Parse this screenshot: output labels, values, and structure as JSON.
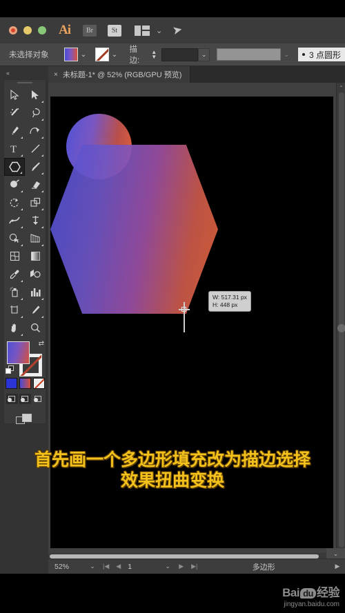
{
  "titlebar": {
    "app_name": "Ai",
    "bridge_label": "Br",
    "stock_label": "St",
    "arrange_icon": "arrange-documents-icon",
    "chevron_icon": "chevron-down-icon",
    "rocket_icon": "rocket-icon",
    "close_dot": "close-window-dot",
    "minimize_dot": "minimize-window-dot",
    "zoom_dot": "zoom-window-dot"
  },
  "controlbar": {
    "selection_status": "未选择对象",
    "fill_swatch_name": "fill-color-swatch",
    "stroke_swatch_name": "stroke-color-swatch",
    "stroke_label": "描边:",
    "stroke_weight_value": "",
    "stroke_profile_value": "",
    "brush_preset_label": "3 点圆形",
    "chevron": "⌄"
  },
  "tab": {
    "close_icon": "×",
    "title": "未标题-1* @ 52% (RGB/GPU 预览)"
  },
  "toolbar": {
    "collapse_icon": "«",
    "tools": [
      {
        "name": "selection-tool",
        "glyph": "selection"
      },
      {
        "name": "direct-selection-tool",
        "glyph": "direct-selection"
      },
      {
        "name": "magic-wand-tool",
        "glyph": "magic-wand"
      },
      {
        "name": "lasso-tool",
        "glyph": "lasso"
      },
      {
        "name": "pen-tool",
        "glyph": "pen"
      },
      {
        "name": "curvature-tool",
        "glyph": "curvature"
      },
      {
        "name": "type-tool",
        "glyph": "T"
      },
      {
        "name": "line-segment-tool",
        "glyph": "line"
      },
      {
        "name": "polygon-tool",
        "glyph": "polygon",
        "active": true
      },
      {
        "name": "paintbrush-tool",
        "glyph": "brush"
      },
      {
        "name": "shaper-tool",
        "glyph": "shaper"
      },
      {
        "name": "eraser-tool",
        "glyph": "eraser"
      },
      {
        "name": "rotate-tool",
        "glyph": "rotate"
      },
      {
        "name": "scale-tool",
        "glyph": "scale"
      },
      {
        "name": "width-tool",
        "glyph": "warp"
      },
      {
        "name": "free-transform-tool",
        "glyph": "pushpin"
      },
      {
        "name": "shape-builder-tool",
        "glyph": "shape-builder"
      },
      {
        "name": "perspective-grid-tool",
        "glyph": "perspective"
      },
      {
        "name": "mesh-tool",
        "glyph": "mesh"
      },
      {
        "name": "gradient-tool",
        "glyph": "gradient"
      },
      {
        "name": "eyedropper-tool",
        "glyph": "eyedropper"
      },
      {
        "name": "blend-tool",
        "glyph": "blend"
      },
      {
        "name": "symbol-sprayer-tool",
        "glyph": "sprayer"
      },
      {
        "name": "column-graph-tool",
        "glyph": "graph"
      },
      {
        "name": "artboard-tool",
        "glyph": "artboard"
      },
      {
        "name": "slice-tool",
        "glyph": "slice"
      },
      {
        "name": "hand-tool",
        "glyph": "hand"
      },
      {
        "name": "zoom-tool",
        "glyph": "zoom"
      }
    ],
    "fill_swatch_name": "toolbar-fill-swatch",
    "stroke_swatch_name": "toolbar-stroke-swatch",
    "swap_icon": "swap-fill-stroke-icon",
    "default_icon": "default-fill-stroke-icon",
    "color_modes": [
      "solid-color-mode",
      "gradient-color-mode",
      "none-color-mode"
    ],
    "draw_modes": [
      "draw-normal-mode",
      "draw-behind-mode",
      "draw-inside-mode"
    ],
    "screen_mode": "change-screen-mode-icon"
  },
  "canvas": {
    "artboard_background": "#000000",
    "circle": {
      "name": "ellipse-shape",
      "gradient_from": "#5153d6",
      "gradient_to": "#e2613a"
    },
    "hexagon": {
      "name": "polygon-shape",
      "gradient_from": "#4e50d4",
      "gradient_to": "#e4643a"
    },
    "cursor": "crosshair-cursor",
    "tooltip": {
      "width_line": "W: 517.31 px",
      "height_line": "H: 448 px"
    }
  },
  "statusbar": {
    "zoom_level": "52%",
    "zoom_chevron": "⌄",
    "nav_first": "|◀",
    "nav_prev": "◀",
    "page_number": "1",
    "page_chevron": "⌄",
    "nav_next": "▶",
    "nav_last": "▶|",
    "active_tool": "多边形",
    "overflow_arrow": "▶"
  },
  "subtitle": {
    "line1": "首先画一个多边形填充改为描边选择",
    "line2": "效果扭曲变换",
    "color": "#f5c21c"
  },
  "watermark": {
    "brand_left": "Bai",
    "brand_bubble": "du",
    "brand_right": "经验",
    "url": "jingyan.baidu.com"
  }
}
